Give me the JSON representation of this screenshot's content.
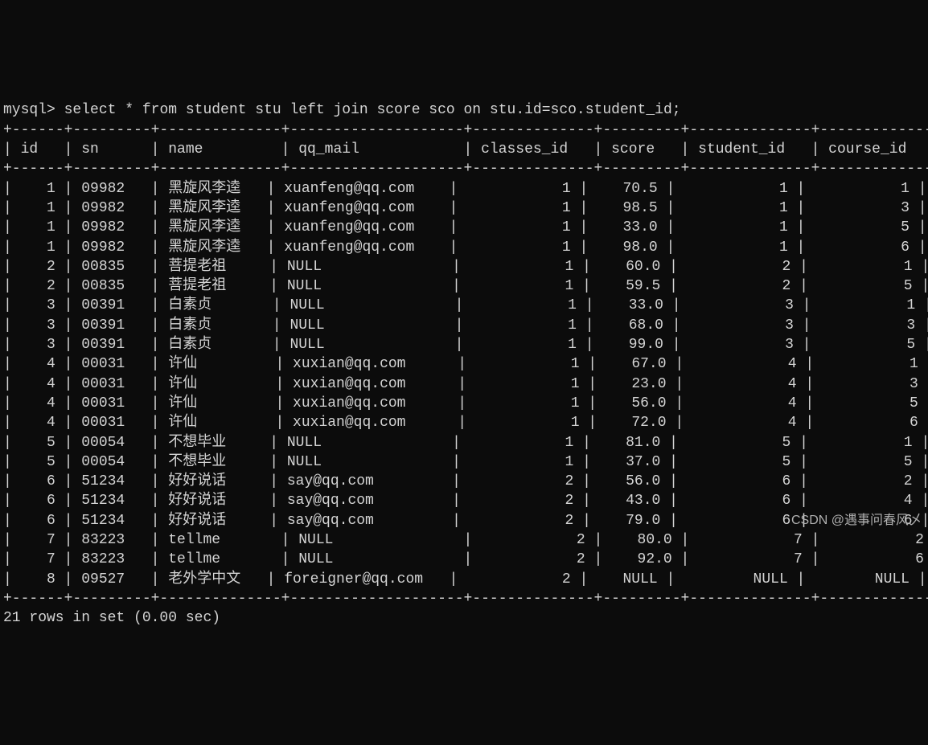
{
  "prompt": "mysql>",
  "query": "select * from student stu left join score sco on stu.id=sco.student_id;",
  "columns": [
    "id",
    "sn",
    "name",
    "qq_mail",
    "classes_id",
    "score",
    "student_id",
    "course_id"
  ],
  "rows": [
    {
      "id": "1",
      "sn": "09982",
      "name": "黑旋风李逵",
      "qq_mail": "xuanfeng@qq.com",
      "classes_id": "1",
      "score": "70.5",
      "student_id": "1",
      "course_id": "1"
    },
    {
      "id": "1",
      "sn": "09982",
      "name": "黑旋风李逵",
      "qq_mail": "xuanfeng@qq.com",
      "classes_id": "1",
      "score": "98.5",
      "student_id": "1",
      "course_id": "3"
    },
    {
      "id": "1",
      "sn": "09982",
      "name": "黑旋风李逵",
      "qq_mail": "xuanfeng@qq.com",
      "classes_id": "1",
      "score": "33.0",
      "student_id": "1",
      "course_id": "5"
    },
    {
      "id": "1",
      "sn": "09982",
      "name": "黑旋风李逵",
      "qq_mail": "xuanfeng@qq.com",
      "classes_id": "1",
      "score": "98.0",
      "student_id": "1",
      "course_id": "6"
    },
    {
      "id": "2",
      "sn": "00835",
      "name": "菩提老祖",
      "qq_mail": "NULL",
      "classes_id": "1",
      "score": "60.0",
      "student_id": "2",
      "course_id": "1"
    },
    {
      "id": "2",
      "sn": "00835",
      "name": "菩提老祖",
      "qq_mail": "NULL",
      "classes_id": "1",
      "score": "59.5",
      "student_id": "2",
      "course_id": "5"
    },
    {
      "id": "3",
      "sn": "00391",
      "name": "白素贞",
      "qq_mail": "NULL",
      "classes_id": "1",
      "score": "33.0",
      "student_id": "3",
      "course_id": "1"
    },
    {
      "id": "3",
      "sn": "00391",
      "name": "白素贞",
      "qq_mail": "NULL",
      "classes_id": "1",
      "score": "68.0",
      "student_id": "3",
      "course_id": "3"
    },
    {
      "id": "3",
      "sn": "00391",
      "name": "白素贞",
      "qq_mail": "NULL",
      "classes_id": "1",
      "score": "99.0",
      "student_id": "3",
      "course_id": "5"
    },
    {
      "id": "4",
      "sn": "00031",
      "name": "许仙",
      "qq_mail": "xuxian@qq.com",
      "classes_id": "1",
      "score": "67.0",
      "student_id": "4",
      "course_id": "1"
    },
    {
      "id": "4",
      "sn": "00031",
      "name": "许仙",
      "qq_mail": "xuxian@qq.com",
      "classes_id": "1",
      "score": "23.0",
      "student_id": "4",
      "course_id": "3"
    },
    {
      "id": "4",
      "sn": "00031",
      "name": "许仙",
      "qq_mail": "xuxian@qq.com",
      "classes_id": "1",
      "score": "56.0",
      "student_id": "4",
      "course_id": "5"
    },
    {
      "id": "4",
      "sn": "00031",
      "name": "许仙",
      "qq_mail": "xuxian@qq.com",
      "classes_id": "1",
      "score": "72.0",
      "student_id": "4",
      "course_id": "6"
    },
    {
      "id": "5",
      "sn": "00054",
      "name": "不想毕业",
      "qq_mail": "NULL",
      "classes_id": "1",
      "score": "81.0",
      "student_id": "5",
      "course_id": "1"
    },
    {
      "id": "5",
      "sn": "00054",
      "name": "不想毕业",
      "qq_mail": "NULL",
      "classes_id": "1",
      "score": "37.0",
      "student_id": "5",
      "course_id": "5"
    },
    {
      "id": "6",
      "sn": "51234",
      "name": "好好说话",
      "qq_mail": "say@qq.com",
      "classes_id": "2",
      "score": "56.0",
      "student_id": "6",
      "course_id": "2"
    },
    {
      "id": "6",
      "sn": "51234",
      "name": "好好说话",
      "qq_mail": "say@qq.com",
      "classes_id": "2",
      "score": "43.0",
      "student_id": "6",
      "course_id": "4"
    },
    {
      "id": "6",
      "sn": "51234",
      "name": "好好说话",
      "qq_mail": "say@qq.com",
      "classes_id": "2",
      "score": "79.0",
      "student_id": "6",
      "course_id": "6"
    },
    {
      "id": "7",
      "sn": "83223",
      "name": "tellme",
      "qq_mail": "NULL",
      "classes_id": "2",
      "score": "80.0",
      "student_id": "7",
      "course_id": "2"
    },
    {
      "id": "7",
      "sn": "83223",
      "name": "tellme",
      "qq_mail": "NULL",
      "classes_id": "2",
      "score": "92.0",
      "student_id": "7",
      "course_id": "6"
    },
    {
      "id": "8",
      "sn": "09527",
      "name": "老外学中文",
      "qq_mail": "foreigner@qq.com",
      "classes_id": "2",
      "score": "NULL",
      "student_id": "NULL",
      "course_id": "NULL"
    }
  ],
  "footer": "21 rows in set (0.00 sec)",
  "watermark": "CSDN @遇事问春风乄",
  "col_widths": {
    "id": 4,
    "sn": 7,
    "name": 12,
    "qq_mail": 18,
    "classes_id": 12,
    "score": 7,
    "student_id": 12,
    "course_id": 11
  },
  "name_cjk_width": 10
}
